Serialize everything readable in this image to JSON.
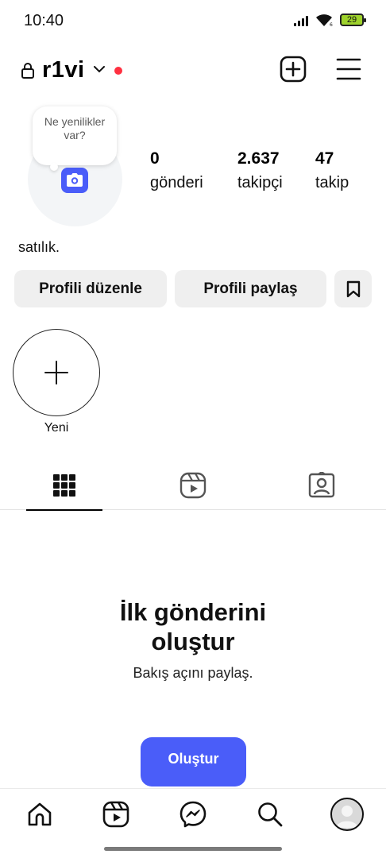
{
  "status_bar": {
    "time": "10:40",
    "battery": "29",
    "icons": [
      "signal-icon",
      "wifi-icon",
      "battery-icon"
    ]
  },
  "header": {
    "username": "r1vi",
    "icons": [
      "lock-icon",
      "chevron-down-icon",
      "add-post-icon",
      "menu-icon"
    ],
    "notification_dot_color": "#ff3040"
  },
  "profile": {
    "note_bubble": "Ne yenilikler var?",
    "stats": [
      {
        "value": "0",
        "label": "gönderi"
      },
      {
        "value": "2.637",
        "label": "takipçi"
      },
      {
        "value": "47",
        "label": "takip"
      }
    ],
    "bio": "satılık."
  },
  "buttons": {
    "edit_profile": "Profili düzenle",
    "share_profile": "Profili paylaş"
  },
  "highlights": {
    "new_label": "Yeni"
  },
  "tabs": [
    {
      "icon": "grid-icon",
      "active": true
    },
    {
      "icon": "reels-icon",
      "active": false
    },
    {
      "icon": "tagged-icon",
      "active": false
    }
  ],
  "empty_state": {
    "title_line1": "İlk gönderini",
    "title_line2": "oluştur",
    "subtitle": "Bakış açını paylaş.",
    "button": "Oluştur"
  },
  "bottom_nav": {
    "items": [
      "home-icon",
      "reels-icon",
      "messenger-icon",
      "search-icon",
      "profile-avatar"
    ]
  },
  "colors": {
    "accent": "#4a5df9",
    "button_bg": "#efefef",
    "avatar_bg": "#f3f5f7"
  }
}
